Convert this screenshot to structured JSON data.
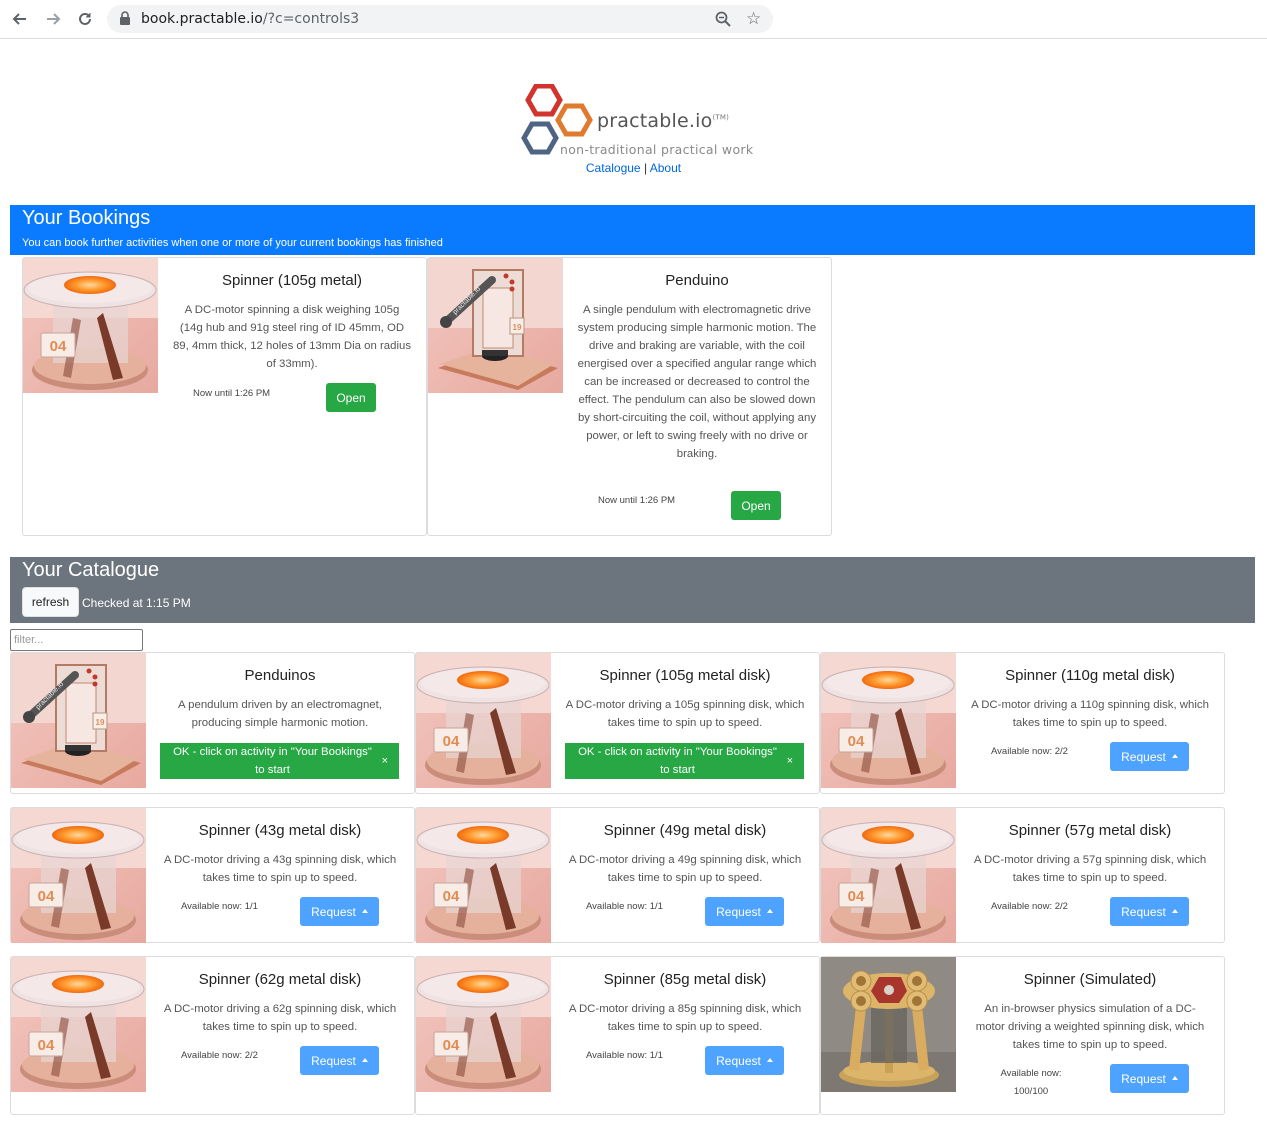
{
  "browser": {
    "url_host": "book.practable.io",
    "url_rest": "/?c=controls3"
  },
  "header": {
    "brand": "practable.io",
    "trademark": "(TM)",
    "tagline": "non-traditional practical work",
    "link_catalogue": "Catalogue",
    "separator": "|",
    "link_about": "About"
  },
  "bookings": {
    "title": "Your Bookings",
    "subtitle": "You can book further activities when one or more of your current bookings has finished",
    "items": [
      {
        "title": "Spinner (105g metal)",
        "description": "A DC-motor spinning a disk weighing 105g (14g hub and 91g steel ring of ID 45mm, OD 89, 4mm thick, 12 holes of 13mm Dia on radius of 33mm).",
        "status": "Now until 1:26 PM",
        "button": "Open",
        "image": "spinner"
      },
      {
        "title": "Penduino",
        "description": "A single pendulum with electromagnetic drive system producing simple harmonic motion. The drive and braking are variable, with the coil energised over a specified angular range which can be increased or decreased to control the effect. The pendulum can also be slowed down by short-circuiting the coil, without applying any power, or left to swing freely with no drive or braking.",
        "status": "Now until 1:26 PM",
        "button": "Open",
        "image": "pendulum"
      }
    ]
  },
  "catalogue": {
    "title": "Your Catalogue",
    "refresh_label": "refresh",
    "checked": "Checked at 1:15 PM",
    "filter_placeholder": "filter...",
    "items": [
      {
        "title": "Penduinos",
        "description": "A pendulum driven by an electromagnet, producing simple harmonic motion.",
        "alert": "OK - click on activity in \"Your Bookings\" to start",
        "close": "×",
        "image": "pendulum"
      },
      {
        "title": "Spinner (105g metal disk)",
        "description": "A DC-motor driving a 105g spinning disk, which takes time to spin up to speed.",
        "alert": "OK - click on activity in \"Your Bookings\" to start",
        "close": "×",
        "image": "spinner"
      },
      {
        "title": "Spinner (110g metal disk)",
        "description": "A DC-motor driving a 110g spinning disk, which takes time to spin up to speed.",
        "available": "Available now: 2/2",
        "button": "Request",
        "image": "spinner"
      },
      {
        "title": "Spinner (43g metal disk)",
        "description": "A DC-motor driving a 43g spinning disk, which takes time to spin up to speed.",
        "available": "Available now: 1/1",
        "button": "Request",
        "image": "spinner"
      },
      {
        "title": "Spinner (49g metal disk)",
        "description": "A DC-motor driving a 49g spinning disk, which takes time to spin up to speed.",
        "available": "Available now: 1/1",
        "button": "Request",
        "image": "spinner"
      },
      {
        "title": "Spinner (57g metal disk)",
        "description": "A DC-motor driving a 57g spinning disk, which takes time to spin up to speed.",
        "available": "Available now: 2/2",
        "button": "Request",
        "image": "spinner"
      },
      {
        "title": "Spinner (62g metal disk)",
        "description": "A DC-motor driving a 62g spinning disk, which takes time to spin up to speed.",
        "available": "Available now: 2/2",
        "button": "Request",
        "image": "spinner"
      },
      {
        "title": "Spinner (85g metal disk)",
        "description": "A DC-motor driving a 85g spinning disk, which takes time to spin up to speed.",
        "available": "Available now: 1/1",
        "button": "Request",
        "image": "spinner"
      },
      {
        "title": "Spinner (Simulated)",
        "description": "An in-browser physics simulation of a DC-motor driving a weighted spinning disk, which takes time to spin up to speed.",
        "available_line1": "Available now:",
        "available_line2": "100/100",
        "button": "Request",
        "image": "simulated"
      }
    ]
  },
  "spinner_label": "04",
  "pendulum_label": "practable.io",
  "pendulum_tag": "19",
  "colors": {
    "booking_banner": "#0a7aff",
    "catalogue_banner": "#6c757d",
    "open_button": "#28a745",
    "request_button": "#4da3ff",
    "link": "#0066dd"
  }
}
